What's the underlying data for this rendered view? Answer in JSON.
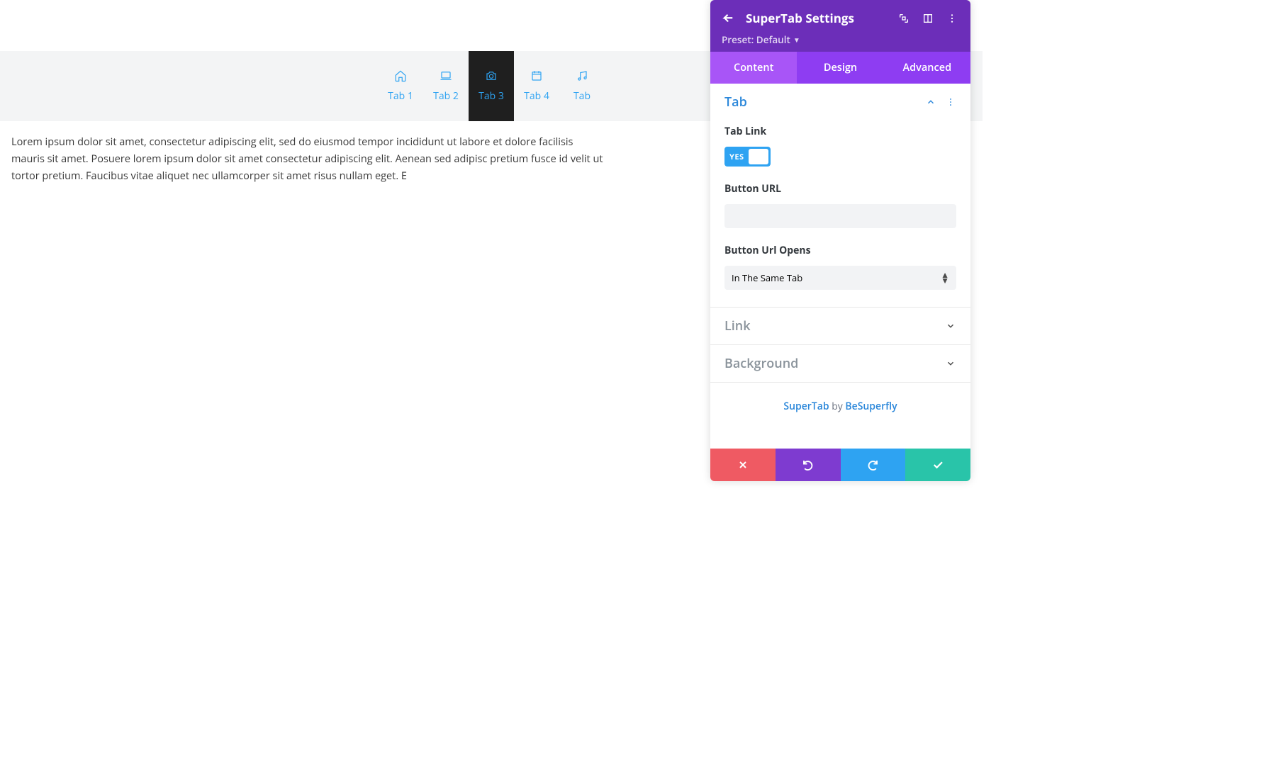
{
  "tabs": {
    "items": [
      {
        "label": "Tab 1",
        "icon": "home-icon"
      },
      {
        "label": "Tab 2",
        "icon": "laptop-icon"
      },
      {
        "label": "Tab 3",
        "icon": "camera-icon"
      },
      {
        "label": "Tab 4",
        "icon": "calendar-icon"
      },
      {
        "label": "Tab",
        "icon": "music-icon"
      }
    ],
    "active_index": 2
  },
  "body_text": "Lorem ipsum dolor sit amet, consectetur adipiscing elit, sed do eiusmod tempor incididunt ut labore et dolore facilisis mauris sit amet. Posuere lorem ipsum dolor sit amet consectetur adipiscing elit. Aenean sed adipisc pretium fusce id velit ut tortor pretium. Faucibus vitae aliquet nec ullamcorper sit amet risus nullam eget. E",
  "panel": {
    "title": "SuperTab Settings",
    "preset_label": "Preset: Default",
    "tabs": {
      "content": "Content",
      "design": "Design",
      "advanced": "Advanced",
      "active": "content"
    },
    "sections": {
      "tab": {
        "title": "Tab",
        "open": true,
        "fields": {
          "tab_link_label": "Tab Link",
          "tab_link_value": "YES",
          "button_url_label": "Button URL",
          "button_url_value": "",
          "opens_label": "Button Url Opens",
          "opens_value": "In The Same Tab"
        }
      },
      "link": {
        "title": "Link"
      },
      "background": {
        "title": "Background"
      }
    },
    "credit": {
      "product": "SuperTab",
      "by": " by ",
      "author": "BeSuperfly"
    }
  }
}
